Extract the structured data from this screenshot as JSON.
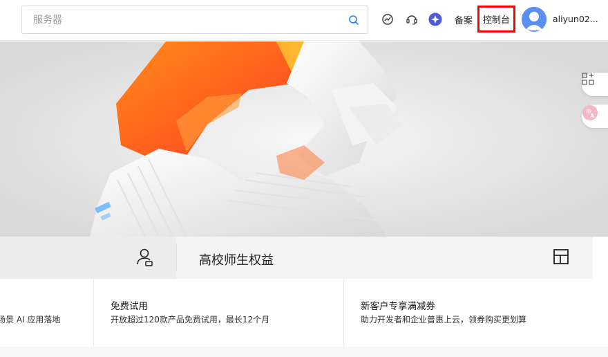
{
  "header": {
    "search": {
      "placeholder": "服务器",
      "value": ""
    },
    "icons": [
      "dashboard-icon",
      "support-headset-icon",
      "ai-assistant-icon"
    ],
    "beian_label": "备案",
    "console_label": "控制台",
    "username": "aliyun02..."
  },
  "hero": {
    "float_buttons": [
      "apps-plus-icon",
      "translate-icon"
    ]
  },
  "benefits": {
    "title": "高校师生权益"
  },
  "cards": [
    {
      "title": "",
      "desc": "场景 AI 应用落地"
    },
    {
      "title": "免费试用",
      "desc": "开放超过120款产品免费试用，最长12个月"
    },
    {
      "title": "新客户专享满减券",
      "desc": "助力开发者和企业普惠上云，领券购买更划算"
    }
  ],
  "colors": {
    "highlight": "#ff0000",
    "accent_blue": "#1677ff",
    "hero_orange": "#ff6a1a"
  }
}
